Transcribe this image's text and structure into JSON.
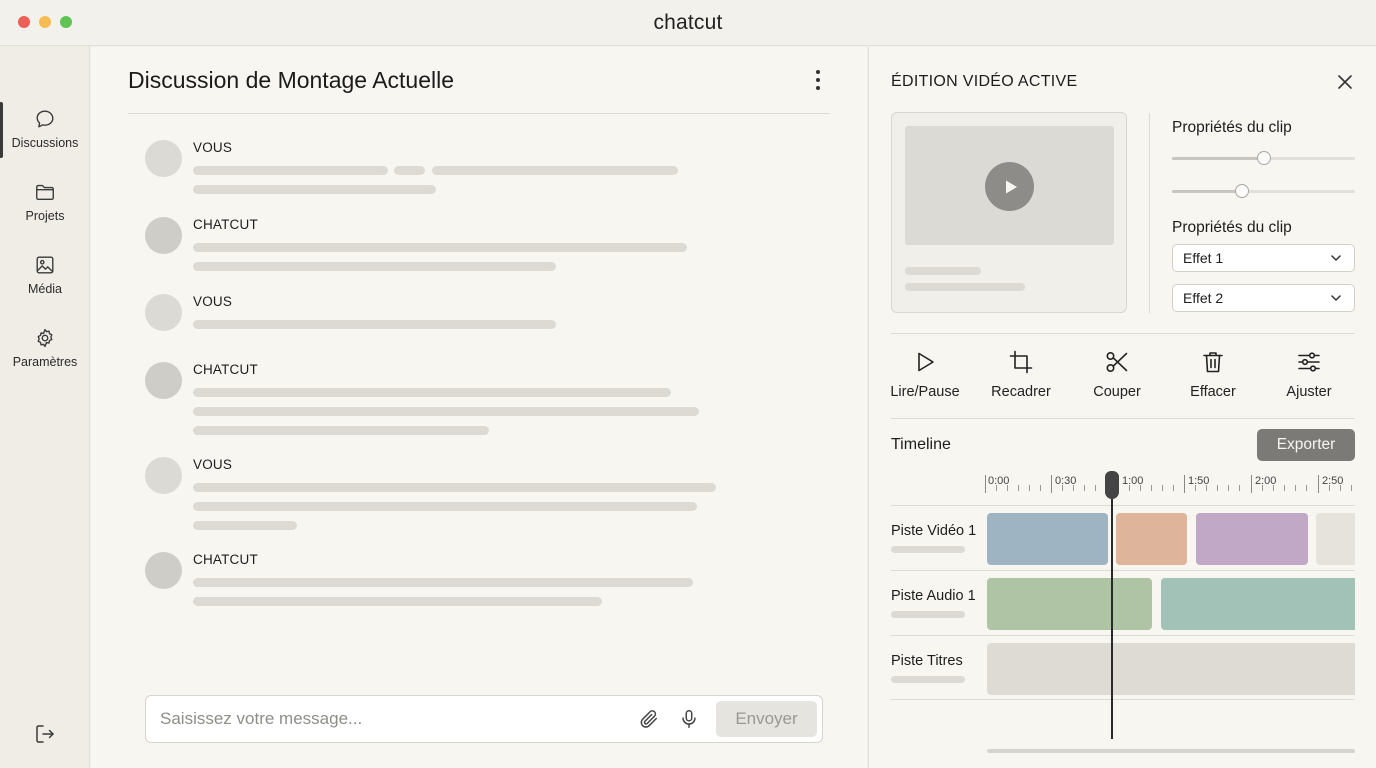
{
  "window": {
    "title": "chatcut"
  },
  "sidebar": {
    "items": [
      {
        "label": "Discussions",
        "icon": "chat-bubble-icon",
        "active": true
      },
      {
        "label": "Projets",
        "icon": "folder-icon"
      },
      {
        "label": "Média",
        "icon": "image-icon"
      },
      {
        "label": "Paramètres",
        "icon": "gear-icon"
      }
    ],
    "logout_icon": "logout-icon"
  },
  "chat": {
    "title": "Discussion de Montage Actuelle",
    "messages": [
      {
        "sender": "VOUS"
      },
      {
        "sender": "CHATCUT"
      },
      {
        "sender": "VOUS"
      },
      {
        "sender": "CHATCUT"
      },
      {
        "sender": "VOUS"
      },
      {
        "sender": "CHATCUT"
      }
    ],
    "composer": {
      "placeholder": "Saisissez votre message...",
      "value": "",
      "send_label": "Envoyer"
    }
  },
  "editor": {
    "title": "ÉDITION VIDÉO ACTIVE",
    "properties": {
      "section1_title": "Propriétés du clip",
      "slider1_value": 0.5,
      "slider2_value": 0.38,
      "section2_title": "Propriétés du clip",
      "effect1": "Effet 1",
      "effect2": "Effet 2"
    },
    "tools": [
      {
        "label": "Lire/Pause",
        "icon": "play-icon"
      },
      {
        "label": "Recadrer",
        "icon": "crop-icon"
      },
      {
        "label": "Couper",
        "icon": "scissors-icon"
      },
      {
        "label": "Effacer",
        "icon": "trash-icon"
      },
      {
        "label": "Ajuster",
        "icon": "sliders-icon"
      }
    ],
    "timeline": {
      "title": "Timeline",
      "export_label": "Exporter",
      "ticks": [
        "0:00",
        "0:30",
        "1:00",
        "1:50",
        "2:00",
        "2:50"
      ],
      "tracks": [
        {
          "label": "Piste Vidéo 1"
        },
        {
          "label": "Piste Audio 1"
        },
        {
          "label": "Piste Titres"
        }
      ],
      "colors": {
        "video_clip_1": "#9fb4c2",
        "video_clip_2": "#deb59a",
        "video_clip_3": "#c0a8c6",
        "video_clip_4": "#e6e3dd",
        "audio_clip_1": "#afc4a4",
        "audio_clip_2": "#a2c2b8",
        "title_clip": "#dedbd5"
      }
    }
  }
}
